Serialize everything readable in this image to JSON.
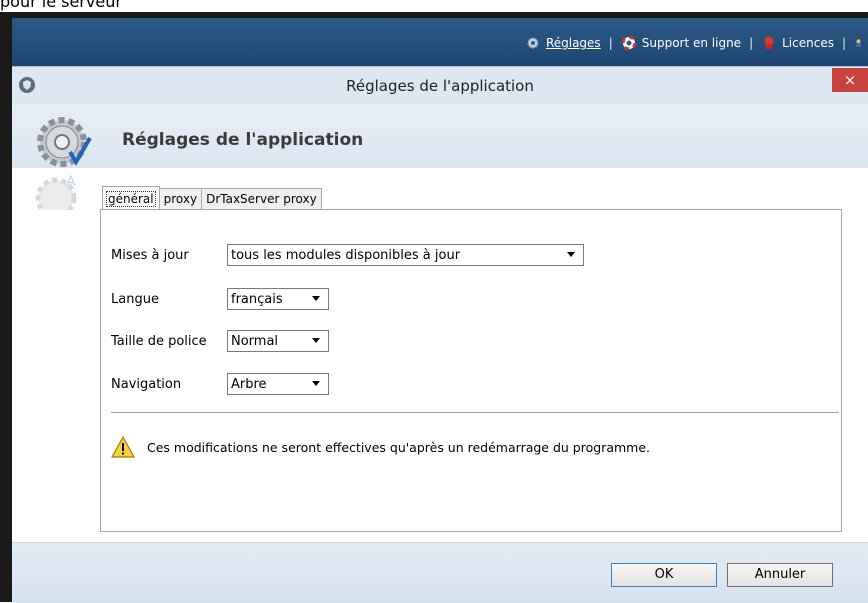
{
  "top_clip_text": "pour le serveur",
  "toplinks": {
    "settings": "Réglages",
    "separator": "|",
    "support": "Support en ligne",
    "licenses": "Licences"
  },
  "dialog": {
    "window_title": "Réglages de l'application",
    "close": "×",
    "header_title": "Réglages de l'application"
  },
  "tabs": [
    "général",
    "proxy",
    "DrTaxServer proxy"
  ],
  "form": {
    "updates_label": "Mises à jour",
    "updates_value": "tous les modules disponibles à jour",
    "language_label": "Langue",
    "language_value": "français",
    "fontsize_label": "Taille de police",
    "fontsize_value": "Normal",
    "navigation_label": "Navigation",
    "navigation_value": "Arbre"
  },
  "note": "Ces modifications ne seront effectives qu'après un redémarrage du programme.",
  "buttons": {
    "ok": "OK",
    "cancel": "Annuler"
  },
  "colors": {
    "topbar": "#23507b",
    "close": "#c7423b",
    "accent": "#3c7fb1"
  }
}
